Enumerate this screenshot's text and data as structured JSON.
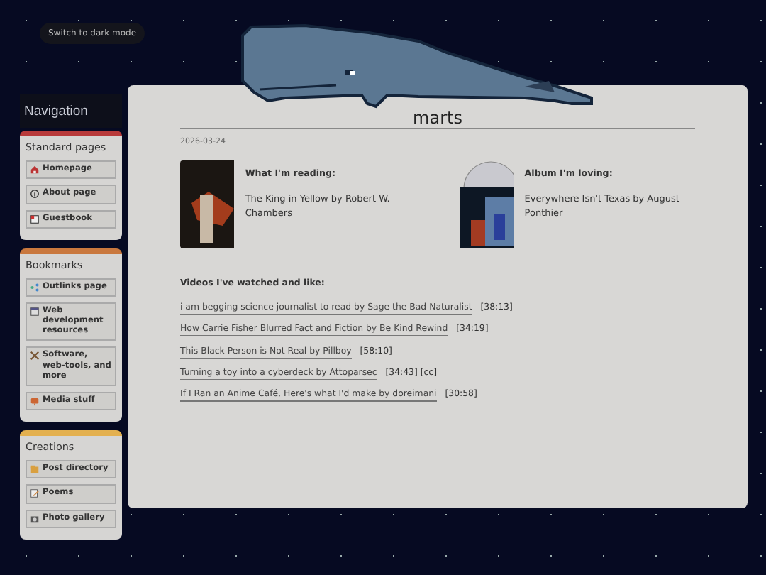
{
  "theme_toggle": {
    "label": "Switch to dark mode"
  },
  "sidebar": {
    "title": "Navigation",
    "groups": [
      {
        "title": "Standard pages",
        "color": "#b83a3a",
        "items": [
          "Homepage",
          "About page",
          "Guestbook"
        ]
      },
      {
        "title": "Bookmarks",
        "color": "#c9783e",
        "items": [
          "Outlinks page",
          "Web development resources",
          "Software, web-tools, and more",
          "Media stuff"
        ]
      },
      {
        "title": "Creations",
        "color": "#e3b04f",
        "items": [
          "Post directory",
          "Poems",
          "Photo gallery"
        ]
      }
    ]
  },
  "post": {
    "title": "marts",
    "date": "2026-03-24",
    "features": [
      {
        "kind": "book",
        "heading": "What I'm reading:",
        "text": "The King in Yellow by Robert W. Chambers"
      },
      {
        "kind": "album",
        "heading": "Album I'm loving:",
        "text": "Everywhere Isn't Texas by August Ponthier"
      }
    ],
    "videos_heading": "Videos I've watched and like:",
    "videos": [
      {
        "title": "i am begging science journalist to read by Sage the Bad Naturalist",
        "duration": "[38:13]"
      },
      {
        "title": "How Carrie Fisher Blurred Fact and Fiction by Be Kind Rewind",
        "duration": "[34:19]"
      },
      {
        "title": "This Black Person is Not Real by Pillboy",
        "duration": "[58:10]"
      },
      {
        "title": "Turning a toy into a cyberdeck by Attoparsec",
        "duration": "[34:43] [cc]"
      },
      {
        "title": "If I Ran an Anime Café, Here's what I'd make by doreimani",
        "duration": "[30:58]"
      }
    ]
  }
}
